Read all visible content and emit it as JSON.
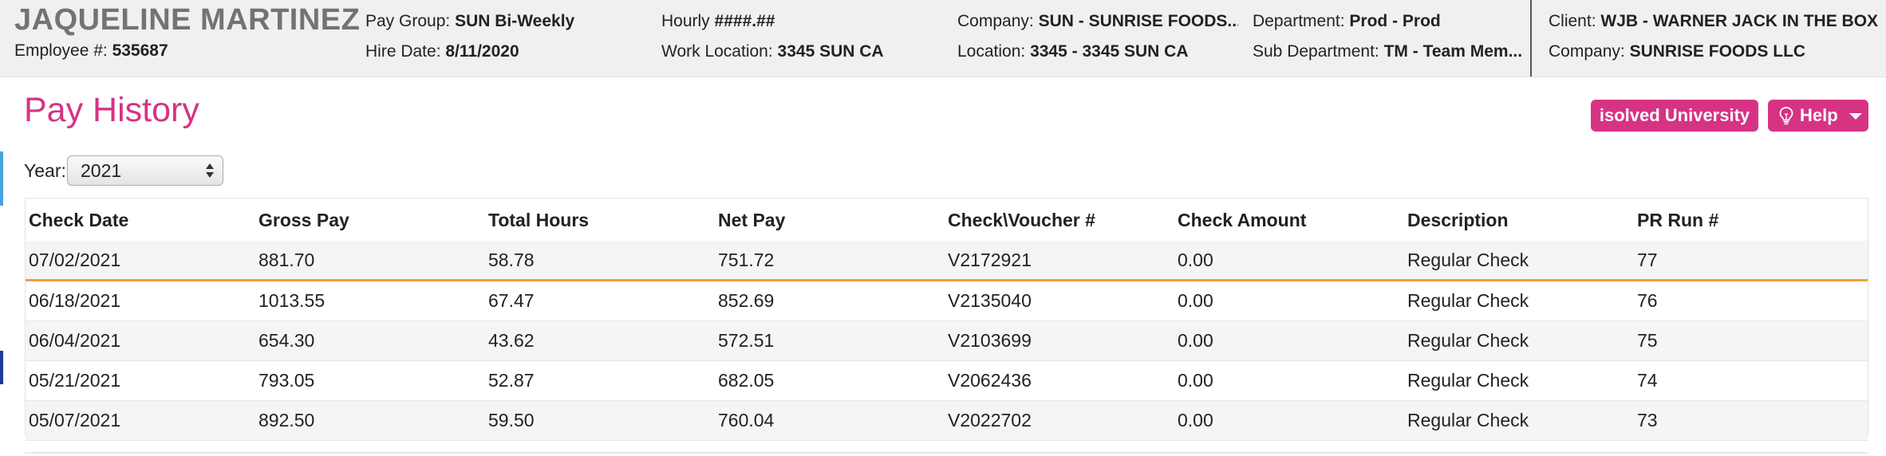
{
  "employee": {
    "name": "JAQUELINE MARTINEZ",
    "number_label": "Employee #:",
    "number": "535687"
  },
  "header_fields": {
    "pay_group": {
      "label": "Pay Group:",
      "value": "SUN Bi-Weekly"
    },
    "hire_date": {
      "label": "Hire Date:",
      "value": "8/11/2020"
    },
    "hourly": {
      "label": "Hourly",
      "value": "####.##"
    },
    "work_location": {
      "label": "Work Location:",
      "value": "3345 SUN CA"
    },
    "company": {
      "label": "Company:",
      "value": "SUN - SUNRISE FOODS..."
    },
    "location": {
      "label": "Location:",
      "value": "3345 - 3345 SUN CA"
    },
    "department": {
      "label": "Department:",
      "value": "Prod - Prod"
    },
    "sub_department": {
      "label": "Sub Department:",
      "value": "TM - Team Mem..."
    },
    "client": {
      "label": "Client:",
      "value": "WJB - WARNER JACK IN THE BOX"
    },
    "client_company": {
      "label": "Company:",
      "value": "SUNRISE FOODS LLC"
    }
  },
  "page": {
    "title": "Pay History"
  },
  "buttons": {
    "university": "isolved University",
    "help": "Help"
  },
  "year_filter": {
    "label": "Year:",
    "value": "2021"
  },
  "table": {
    "columns": [
      "Check Date",
      "Gross Pay",
      "Total Hours",
      "Net Pay",
      "Check\\Voucher #",
      "Check Amount",
      "Description",
      "PR Run #"
    ],
    "rows": [
      [
        "07/02/2021",
        "881.70",
        "58.78",
        "751.72",
        "V2172921",
        "0.00",
        "Regular Check",
        "77"
      ],
      [
        "06/18/2021",
        "1013.55",
        "67.47",
        "852.69",
        "V2135040",
        "0.00",
        "Regular Check",
        "76"
      ],
      [
        "06/04/2021",
        "654.30",
        "43.62",
        "572.51",
        "V2103699",
        "0.00",
        "Regular Check",
        "75"
      ],
      [
        "05/21/2021",
        "793.05",
        "52.87",
        "682.05",
        "V2062436",
        "0.00",
        "Regular Check",
        "74"
      ],
      [
        "05/07/2021",
        "892.50",
        "59.50",
        "760.04",
        "V2022702",
        "0.00",
        "Regular Check",
        "73"
      ]
    ]
  },
  "colors": {
    "accent": "#d63384",
    "selection": "#e8a33c",
    "name_gray": "#737373"
  },
  "icons": {
    "help_icon": "lightbulb-icon",
    "help_caret": "caret-down-icon",
    "select_arrows": "updown-arrows-icon"
  }
}
